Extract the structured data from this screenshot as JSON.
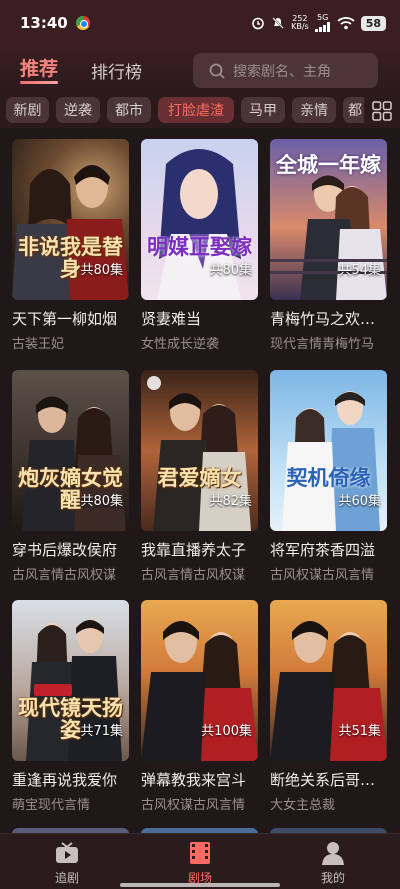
{
  "status": {
    "time": "13:40",
    "net_speed_value": "252",
    "net_speed_unit": "KB/s",
    "network_type": "5G",
    "battery": "58"
  },
  "header": {
    "tab_recommend": "推荐",
    "tab_ranking": "排行榜",
    "search_placeholder": "搜索剧名、主角"
  },
  "categories": [
    "新剧",
    "逆袭",
    "都市",
    "打脸虐渣",
    "马甲",
    "亲情",
    "都"
  ],
  "active_category": "打脸虐渣",
  "cards": [
    {
      "title": "天下第一柳如烟",
      "tags": "古装王妃",
      "episodes": "共80集",
      "poster_text": "非说我是替身"
    },
    {
      "title": "贤妻难当",
      "tags": "女性成长逆袭",
      "episodes": "共80集",
      "poster_text": "明媒正娶嫁"
    },
    {
      "title": "青梅竹马之欢…",
      "tags": "现代言情青梅竹马",
      "episodes": "共54集",
      "poster_text": "全城一年嫁"
    },
    {
      "title": "穿书后爆改侯府",
      "tags": "古风言情古风权谋",
      "episodes": "共80集",
      "poster_text": "炮灰嫡女觉醒"
    },
    {
      "title": "我靠直播养太子",
      "tags": "古风言情古风权谋",
      "episodes": "共82集",
      "poster_text": "君爱嫡女"
    },
    {
      "title": "将军府茶香四溢",
      "tags": "古风权谋古风言情",
      "episodes": "共60集",
      "poster_text": "契机倚缘"
    },
    {
      "title": "重逢再说我爱你",
      "tags": "萌宝现代言情",
      "episodes": "共71集",
      "poster_text": "现代镜天扬姿"
    },
    {
      "title": "弹幕教我来宫斗",
      "tags": "古风权谋古风言情",
      "episodes": "共100集",
      "poster_text": ""
    },
    {
      "title": "断绝关系后哥…",
      "tags": "大女主总裁",
      "episodes": "共51集",
      "poster_text": ""
    }
  ],
  "nav": {
    "follow": "追剧",
    "theater": "剧场",
    "mine": "我的"
  },
  "colors": {
    "accent": "#ff6b62",
    "background": "#1f1718"
  }
}
